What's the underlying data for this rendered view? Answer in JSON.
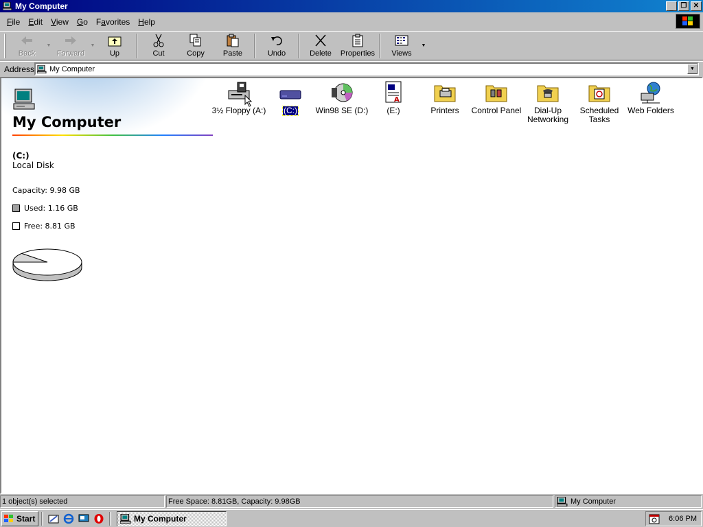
{
  "window": {
    "title": "My Computer"
  },
  "menubar": {
    "items": [
      {
        "label": "File",
        "key": "F",
        "rest": "ile"
      },
      {
        "label": "Edit",
        "key": "E",
        "rest": "dit"
      },
      {
        "label": "View",
        "key": "V",
        "rest": "iew"
      },
      {
        "label": "Go",
        "key": "G",
        "rest": "o"
      },
      {
        "label": "Favorites",
        "key": "a",
        "pre": "F",
        "rest": "vorites"
      },
      {
        "label": "Help",
        "key": "H",
        "rest": "elp"
      }
    ]
  },
  "toolbar": {
    "back": "Back",
    "forward": "Forward",
    "up": "Up",
    "cut": "Cut",
    "copy": "Copy",
    "paste": "Paste",
    "undo": "Undo",
    "delete": "Delete",
    "properties": "Properties",
    "views": "Views"
  },
  "address": {
    "label": "Address",
    "value": "My Computer"
  },
  "info_panel": {
    "title": "My Computer",
    "drive_name": "(C:)",
    "drive_type": "Local Disk",
    "capacity": "Capacity: 9.98 GB",
    "used": "Used: 1.16 GB",
    "free": "Free: 8.81 GB",
    "used_fraction": 0.116
  },
  "icons": [
    {
      "label": "3½ Floppy (A:)",
      "icon": "floppy-drive-icon"
    },
    {
      "label": "(C:)",
      "icon": "hard-drive-icon",
      "selected": true
    },
    {
      "label": "Win98 SE (D:)",
      "icon": "cd-drive-icon"
    },
    {
      "label": "(E:)",
      "icon": "removable-disk-icon"
    },
    {
      "label": "Printers",
      "icon": "printers-folder-icon"
    },
    {
      "label": "Control Panel",
      "icon": "control-panel-folder-icon"
    },
    {
      "label": "Dial-Up Networking",
      "icon": "dialup-folder-icon"
    },
    {
      "label": "Scheduled Tasks",
      "icon": "scheduled-tasks-folder-icon"
    },
    {
      "label": "Web Folders",
      "icon": "web-folders-icon"
    }
  ],
  "statusbar": {
    "selection": "1 object(s) selected",
    "space": "Free Space: 8.81GB,  Capacity: 9.98GB",
    "zone": "My Computer"
  },
  "taskbar": {
    "start": "Start",
    "task": "My Computer",
    "clock": "6:06 PM"
  },
  "colors": {
    "title_start": "#000080",
    "title_end": "#1084d0",
    "selection": "#000080",
    "face": "#c0c0c0"
  }
}
